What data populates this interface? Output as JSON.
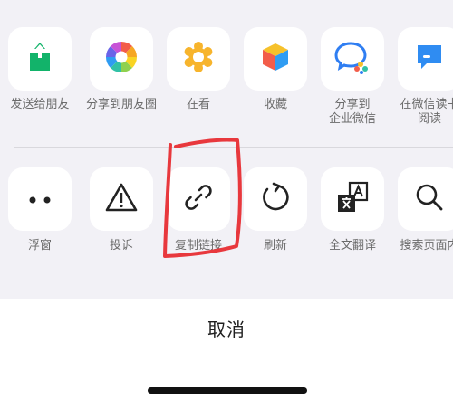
{
  "share_row": [
    {
      "label": "发送给朋友",
      "icon": "send-to-friend-icon"
    },
    {
      "label": "分享到朋友圈",
      "icon": "moments-icon"
    },
    {
      "label": "在看",
      "icon": "wow-icon"
    },
    {
      "label": "收藏",
      "icon": "favorites-cube-icon"
    },
    {
      "label": "分享到\n企业微信",
      "icon": "wecom-icon"
    },
    {
      "label": "在微信读书\n阅读",
      "icon": "weread-icon"
    }
  ],
  "action_row": [
    {
      "label": "浮窗",
      "icon": "floating-window-icon"
    },
    {
      "label": "投诉",
      "icon": "report-warning-icon"
    },
    {
      "label": "复制链接",
      "icon": "link-icon"
    },
    {
      "label": "刷新",
      "icon": "refresh-icon"
    },
    {
      "label": "全文翻译",
      "icon": "translate-icon"
    },
    {
      "label": "搜索页面内",
      "icon": "search-icon"
    }
  ],
  "cancel_label": "取消",
  "colors": {
    "background": "#f2f1f6",
    "tile": "#ffffff",
    "label": "#6b6b6b",
    "annotation_red": "#e8383d",
    "send_green": "#12b36a"
  }
}
